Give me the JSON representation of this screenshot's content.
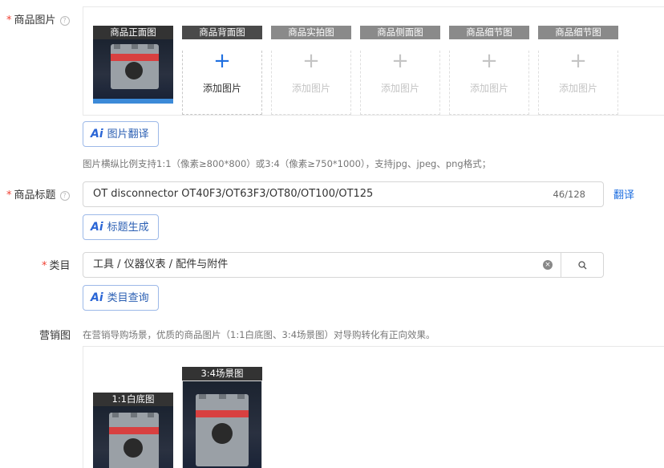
{
  "product_images": {
    "label": "商品图片",
    "required_mark": "*",
    "help": "?",
    "slots": [
      {
        "title": "商品正面图",
        "state": "filled"
      },
      {
        "title": "商品背面图",
        "state": "active",
        "add_label": "添加图片",
        "plus": "+"
      },
      {
        "title": "商品实拍图",
        "state": "inactive",
        "add_label": "添加图片",
        "plus": "+"
      },
      {
        "title": "商品侧面图",
        "state": "inactive",
        "add_label": "添加图片",
        "plus": "+"
      },
      {
        "title": "商品细节图",
        "state": "inactive",
        "add_label": "添加图片",
        "plus": "+"
      },
      {
        "title": "商品细节图",
        "state": "inactive",
        "add_label": "添加图片",
        "plus": "+"
      }
    ],
    "ai_button": {
      "ai": "Ai",
      "label": "图片翻译"
    },
    "hint": "图片横纵比例支持1:1（像素≥800*800）或3:4（像素≥750*1000），支持jpg、jpeg、png格式；"
  },
  "title_field": {
    "label": "商品标题",
    "required_mark": "*",
    "help": "?",
    "value": "OT disconnector OT40F3/OT63F3/OT80/OT100/OT125",
    "counter": "46/128",
    "translate_link": "翻译",
    "ai_button": {
      "ai": "Ai",
      "label": "标题生成"
    }
  },
  "category_field": {
    "label": "类目",
    "required_mark": "*",
    "value": "工具 / 仪器仪表 / 配件与附件",
    "clear": "×",
    "ai_button": {
      "ai": "Ai",
      "label": "类目查询"
    }
  },
  "marketing": {
    "label": "营销图",
    "hint": "在营销导购场景，优质的商品图片（1:1白底图、3:4场景图）对导购转化有正向效果。",
    "images": [
      {
        "title": "1:1白底图"
      },
      {
        "title": "3:4场景图"
      }
    ]
  },
  "colors": {
    "accent": "#1f6fe0",
    "required": "#f04134"
  }
}
